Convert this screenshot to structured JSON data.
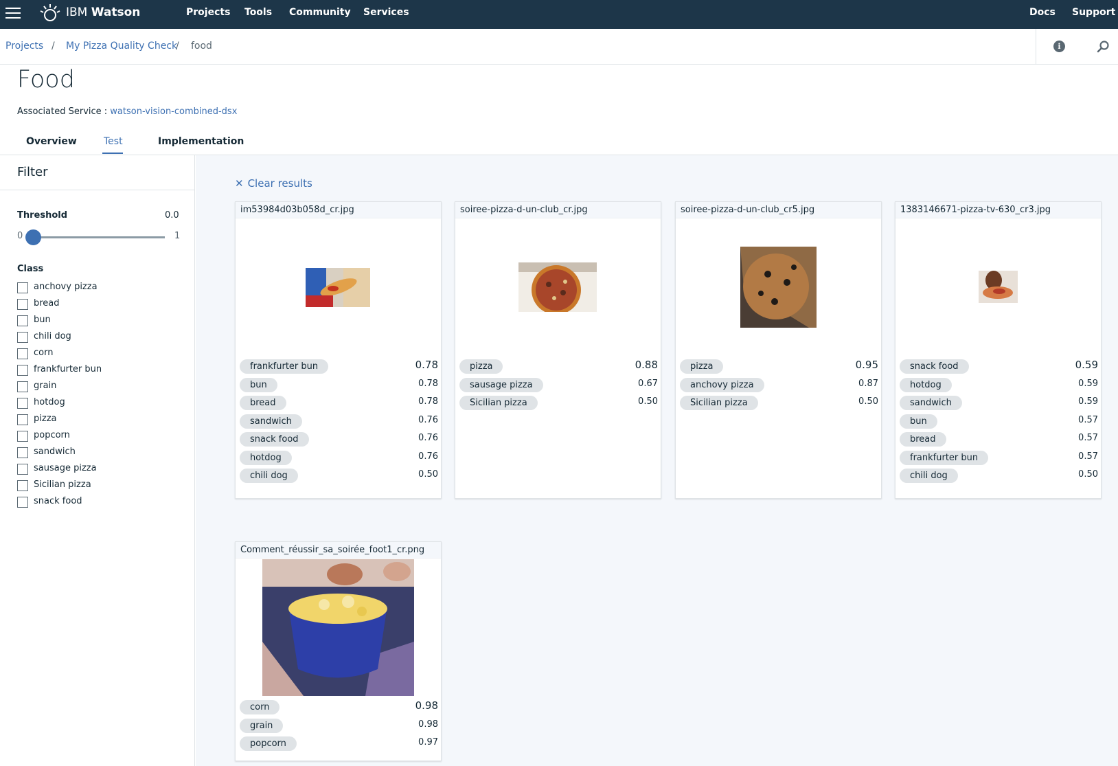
{
  "nav": {
    "brand_prefix": "IBM",
    "brand_bold": "Watson",
    "links": [
      "Projects",
      "Tools",
      "Community",
      "Services"
    ],
    "right_links": [
      "Docs",
      "Support"
    ]
  },
  "breadcrumb": {
    "items": [
      "Projects",
      "My Pizza Quality Check"
    ],
    "current": "food",
    "separator": "/"
  },
  "header": {
    "title": "Food",
    "assoc_label": "Associated Service :",
    "assoc_link": "watson-vision-combined-dsx",
    "tabs": [
      "Overview",
      "Test",
      "Implementation"
    ],
    "active_tab": "Test"
  },
  "filter": {
    "title": "Filter",
    "threshold_label": "Threshold",
    "threshold_value": "0.0",
    "slider_min": "0",
    "slider_max": "1",
    "class_title": "Class",
    "classes": [
      "anchovy pizza",
      "bread",
      "bun",
      "chili dog",
      "corn",
      "frankfurter bun",
      "grain",
      "hotdog",
      "pizza",
      "popcorn",
      "sandwich",
      "sausage pizza",
      "Sicilian pizza",
      "snack food"
    ]
  },
  "main": {
    "clear_label": "Clear results",
    "cards": [
      {
        "filename": "im53984d03b058d_cr.jpg",
        "results": [
          {
            "label": "frankfurter bun",
            "score": "0.78"
          },
          {
            "label": "bun",
            "score": "0.78"
          },
          {
            "label": "bread",
            "score": "0.78"
          },
          {
            "label": "sandwich",
            "score": "0.76"
          },
          {
            "label": "snack food",
            "score": "0.76"
          },
          {
            "label": "hotdog",
            "score": "0.76"
          },
          {
            "label": "chili dog",
            "score": "0.50"
          }
        ]
      },
      {
        "filename": "soiree-pizza-d-un-club_cr.jpg",
        "results": [
          {
            "label": "pizza",
            "score": "0.88"
          },
          {
            "label": "sausage pizza",
            "score": "0.67"
          },
          {
            "label": "Sicilian pizza",
            "score": "0.50"
          }
        ]
      },
      {
        "filename": "soiree-pizza-d-un-club_cr5.jpg",
        "results": [
          {
            "label": "pizza",
            "score": "0.95"
          },
          {
            "label": "anchovy pizza",
            "score": "0.87"
          },
          {
            "label": "Sicilian pizza",
            "score": "0.50"
          }
        ]
      },
      {
        "filename": "1383146671-pizza-tv-630_cr3.jpg",
        "results": [
          {
            "label": "snack food",
            "score": "0.59"
          },
          {
            "label": "hotdog",
            "score": "0.59"
          },
          {
            "label": "sandwich",
            "score": "0.59"
          },
          {
            "label": "bun",
            "score": "0.57"
          },
          {
            "label": "bread",
            "score": "0.57"
          },
          {
            "label": "frankfurter bun",
            "score": "0.57"
          },
          {
            "label": "chili dog",
            "score": "0.50"
          }
        ]
      },
      {
        "filename": "Comment_réussir_sa_soirée_foot1_cr.png",
        "results": [
          {
            "label": "corn",
            "score": "0.98"
          },
          {
            "label": "grain",
            "score": "0.98"
          },
          {
            "label": "popcorn",
            "score": "0.97"
          }
        ]
      }
    ]
  },
  "colors": {
    "nav_bg": "#1d3649",
    "accent": "#3d70b2",
    "main_bg": "#f4f7fb",
    "pill_bg": "#dfe3e6"
  }
}
